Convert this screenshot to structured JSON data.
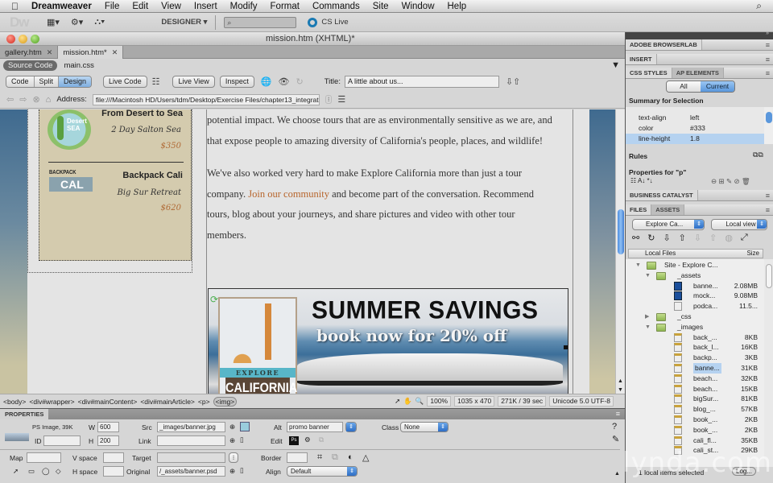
{
  "menubar": {
    "apple": "",
    "app_name": "Dreamweaver",
    "items": [
      "File",
      "Edit",
      "View",
      "Insert",
      "Modify",
      "Format",
      "Commands",
      "Site",
      "Window",
      "Help"
    ],
    "spotlight": "⌕"
  },
  "appbar": {
    "logo": "Dw",
    "layout_icon": "▦▾",
    "gear_icon": "⚙▾",
    "site_icon": "⛬▾",
    "workspace": "DESIGNER ▾",
    "search_value": "⌕",
    "cslive": "CS Live"
  },
  "document": {
    "window_title": "mission.htm (XHTML)*",
    "tabs": [
      {
        "label": "gallery.htm",
        "active": false
      },
      {
        "label": "mission.htm*",
        "active": true
      }
    ],
    "related": {
      "source": "Source Code",
      "file": "main.css"
    },
    "views": {
      "code": "Code",
      "split": "Split",
      "design": "Design",
      "live_code": "Live Code",
      "live_view": "Live View",
      "inspect": "Inspect"
    },
    "title_label": "Title:",
    "title_value": "A little about us...",
    "address_label": "Address:",
    "address_value": "file:///Macintosh HD/Users/tdm/Desktop/Exercise Files/chapter13_integrat"
  },
  "page": {
    "tours": [
      {
        "name": "From Desert to Sea",
        "location": "2 Day Salton Sea",
        "price": "$350",
        "logo": "Desert SEA"
      },
      {
        "name": "Backpack Cali",
        "location": "Big Sur Retreat",
        "price": "$620",
        "logo_top": "BACKPACK",
        "logo_bottom": "CAL"
      }
    ],
    "para1_lines": [
      "potential impact. We choose tours that are as environmentally sensitive as we are, and",
      "that expose people to amazing diversity of California's people, places, and wildlife!"
    ],
    "para2": {
      "line1": "We've also worked very hard to make Explore California more than just a tour",
      "line2_pre": "company. ",
      "link": "Join our community",
      "line2_post": " and become part of the conversation. Recommend",
      "line3": "tours, blog about your journeys, and share pictures and video with other tour",
      "line4": "members."
    },
    "banner": {
      "headline": "SUMMER SAVINGS",
      "subline": "book now for 20% off",
      "logo_top": "EXPLORE",
      "logo_bottom": "CALIFORNIA"
    }
  },
  "statusbar": {
    "tags": [
      "<body>",
      "<div#wrapper>",
      "<div#mainContent>",
      "<div#mainArticle>",
      "<p>"
    ],
    "selected_tag": "<img>",
    "zoom": "100%",
    "dimensions": "1035 x 470",
    "size_time": "271K / 39 sec",
    "encoding": "Unicode 5.0 UTF-8"
  },
  "properties": {
    "title": "PROPERTIES",
    "image_type": "PS Image, 39K",
    "id_label": "ID",
    "id_value": "",
    "w_label": "W",
    "w_value": "600",
    "h_label": "H",
    "h_value": "200",
    "src_label": "Src",
    "src_value": "_images/banner.jpg",
    "link_label": "Link",
    "link_value": "",
    "alt_label": "Alt",
    "alt_value": "promo banner",
    "edit_label": "Edit",
    "class_label": "Class",
    "class_value": "None",
    "map_label": "Map",
    "map_value": "",
    "vspace_label": "V space",
    "hspace_label": "H space",
    "target_label": "Target",
    "original_label": "Original",
    "original_value": "/_assets/banner.psd",
    "border_label": "Border",
    "align_label": "Align",
    "align_value": "Default"
  },
  "right_panels": {
    "browserlab": "ADOBE BROWSERLAB",
    "insert": "INSERT",
    "css_tab": "CSS STYLES",
    "ap_tab": "AP ELEMENTS",
    "toggle_all": "All",
    "toggle_current": "Current",
    "summary_title": "Summary for Selection",
    "css_rows": [
      {
        "prop": "text-align",
        "value": "left",
        "selected": false
      },
      {
        "prop": "color",
        "value": "#333",
        "selected": false
      },
      {
        "prop": "line-height",
        "value": "1.8",
        "selected": true
      }
    ],
    "rules": "Rules",
    "properties_for": "Properties for \"p\"",
    "business_catalyst": "BUSINESS CATALYST",
    "files_tab": "FILES",
    "assets_tab": "ASSETS",
    "site_select": "Explore Ca...",
    "view_select": "Local view",
    "col_local": "Local Files",
    "col_size": "Size",
    "files": [
      {
        "name": "Site - Explore C...",
        "size": "",
        "type": "site",
        "indent": 0,
        "twisty": "▼"
      },
      {
        "name": "_assets",
        "size": "",
        "type": "folder",
        "indent": 1,
        "twisty": "▼"
      },
      {
        "name": "banne...",
        "size": "2.08MB",
        "type": "psd",
        "indent": 2,
        "twisty": ""
      },
      {
        "name": "mock...",
        "size": "9.08MB",
        "type": "psd",
        "indent": 2,
        "twisty": ""
      },
      {
        "name": "podca...",
        "size": "11.5...",
        "type": "file",
        "indent": 2,
        "twisty": ""
      },
      {
        "name": "_css",
        "size": "",
        "type": "folder",
        "indent": 1,
        "twisty": "▶"
      },
      {
        "name": "_images",
        "size": "",
        "type": "folder",
        "indent": 1,
        "twisty": "▼"
      },
      {
        "name": "back_...",
        "size": "8KB",
        "type": "img",
        "indent": 2,
        "twisty": ""
      },
      {
        "name": "back_l...",
        "size": "16KB",
        "type": "img",
        "indent": 2,
        "twisty": ""
      },
      {
        "name": "backp...",
        "size": "3KB",
        "type": "img",
        "indent": 2,
        "twisty": ""
      },
      {
        "name": "banne...",
        "size": "31KB",
        "type": "img",
        "indent": 2,
        "twisty": "",
        "selected": true
      },
      {
        "name": "beach...",
        "size": "32KB",
        "type": "img",
        "indent": 2,
        "twisty": ""
      },
      {
        "name": "beach...",
        "size": "15KB",
        "type": "img",
        "indent": 2,
        "twisty": ""
      },
      {
        "name": "bigSur...",
        "size": "81KB",
        "type": "img",
        "indent": 2,
        "twisty": ""
      },
      {
        "name": "blog_...",
        "size": "57KB",
        "type": "img",
        "indent": 2,
        "twisty": ""
      },
      {
        "name": "book_...",
        "size": "2KB",
        "type": "img",
        "indent": 2,
        "twisty": ""
      },
      {
        "name": "book_...",
        "size": "2KB",
        "type": "img",
        "indent": 2,
        "twisty": ""
      },
      {
        "name": "cali_fl...",
        "size": "35KB",
        "type": "img",
        "indent": 2,
        "twisty": ""
      },
      {
        "name": "cali_st...",
        "size": "29KB",
        "type": "img",
        "indent": 2,
        "twisty": ""
      }
    ],
    "status": "1 local items selected",
    "log_button": "Log..."
  },
  "watermark": "lynda.com"
}
